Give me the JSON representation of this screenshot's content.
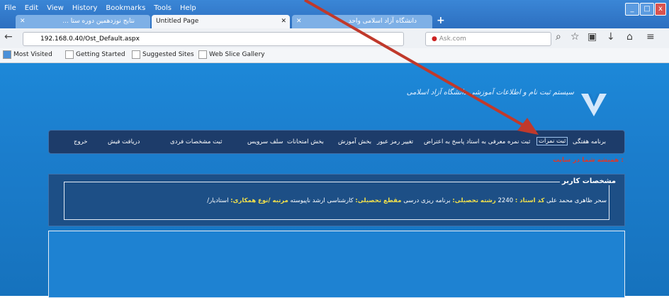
{
  "menubar": {
    "items": [
      "File",
      "Edit",
      "View",
      "History",
      "Bookmarks",
      "Tools",
      "Help"
    ]
  },
  "tabs": [
    {
      "label": "نتایج نوزدهمین دوره ستا ...",
      "state": "inactive"
    },
    {
      "label": "Untitled Page",
      "state": "active"
    },
    {
      "label": "دانشگاه آزاد اسلامی واحد ...",
      "state": "inactive"
    }
  ],
  "nav": {
    "url": "192.168.0.40/Ost_Default.aspx",
    "search_placeholder": "Ask.com"
  },
  "bookmarks": [
    "Most Visited",
    "Getting Started",
    "Suggested Sites",
    "Web Slice Gallery"
  ],
  "site": {
    "title_line1": "سیستم ثبت نام و اطلاعات آموزشی دانشگاه آزاد اسلامی",
    "menu": [
      "برنامه هفتگی",
      "ثبت نمرات",
      "ثبت نمره معرفی به استاد",
      "پاسخ به اعتراض",
      "تغییر رمز عبور",
      "بخش آموزش",
      "بخش امتحانات",
      "سلف سرویس",
      "ثبت مشخصات فردی",
      "دریافت فیش",
      "خروج"
    ],
    "welcome": "همیشه شما در سایت :",
    "user_legend": "مشخصات کاربر",
    "user": {
      "name": "سحر ظاهری محمد علی",
      "code_label": "کد استاد :",
      "code": "2240",
      "field_label": "رشته تحصیلی:",
      "field": "برنامه ریزی درسی",
      "degree_label": "مقطع تحصیلی:",
      "degree": "کارشناسی ارشد ناپیوسته",
      "rank_label": "مرتبه /نوع همکاری:",
      "rank": "استادیار/"
    }
  },
  "colors": {
    "accent": "#d63a2f",
    "page_bg": "#1b7dcc",
    "panel": "#1d3c6a"
  }
}
